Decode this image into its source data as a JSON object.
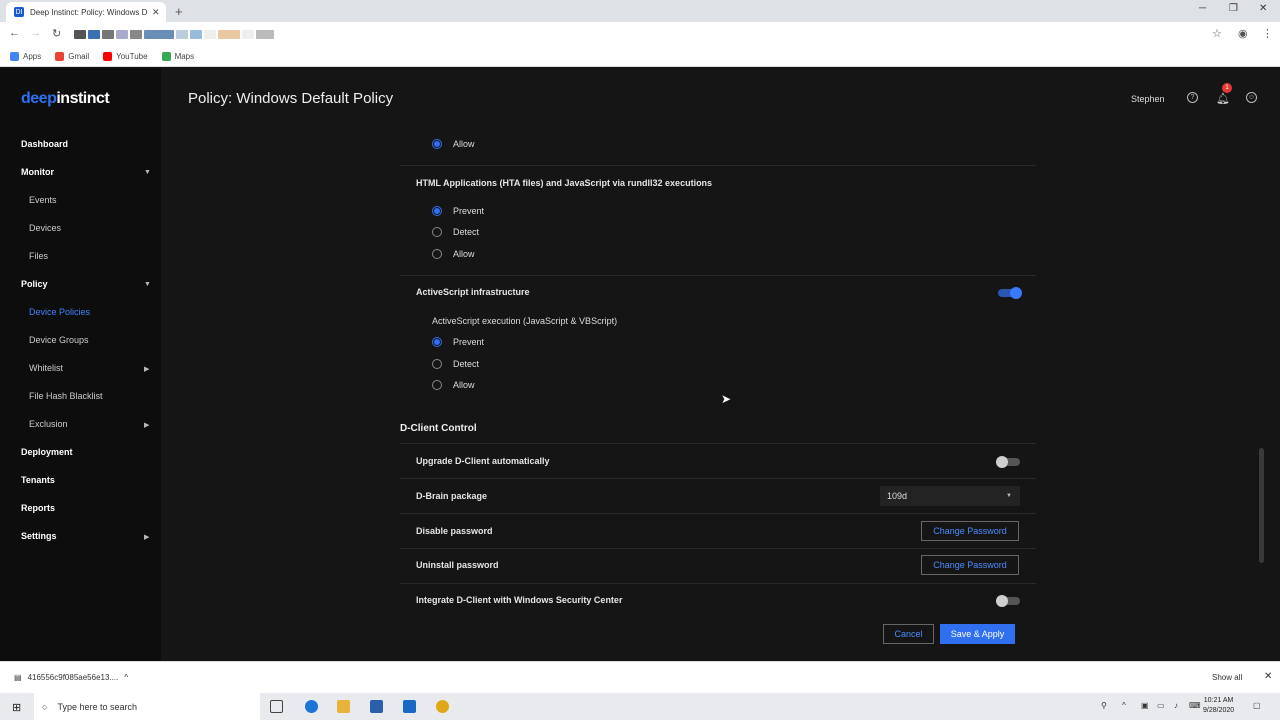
{
  "browser": {
    "tab_title": "Deep Instinct: Policy: Windows D",
    "bookmarks": [
      "Apps",
      "Gmail",
      "YouTube",
      "Maps"
    ]
  },
  "app": {
    "logo_part1": "deep",
    "logo_part2": "instinct",
    "page_title": "Policy: Windows Default Policy",
    "user": "Stephen",
    "notification_count": "1"
  },
  "sidebar": {
    "items": [
      {
        "label": "Dashboard"
      },
      {
        "label": "Monitor"
      },
      {
        "label": "Events"
      },
      {
        "label": "Devices"
      },
      {
        "label": "Files"
      },
      {
        "label": "Policy"
      },
      {
        "label": "Device Policies"
      },
      {
        "label": "Device Groups"
      },
      {
        "label": "Whitelist"
      },
      {
        "label": "File Hash Blacklist"
      },
      {
        "label": "Exclusion"
      },
      {
        "label": "Deployment"
      },
      {
        "label": "Tenants"
      },
      {
        "label": "Reports"
      },
      {
        "label": "Settings"
      }
    ]
  },
  "content": {
    "top_allow": "Allow",
    "hta_title": "HTML Applications (HTA files) and JavaScript via rundll32 executions",
    "hta_options": [
      "Prevent",
      "Detect",
      "Allow"
    ],
    "activescript_title": "ActiveScript infrastructure",
    "activescript_sub": "ActiveScript execution (JavaScript & VBScript)",
    "activescript_options": [
      "Prevent",
      "Detect",
      "Allow"
    ],
    "dclient_section": "D-Client Control",
    "upgrade_label": "Upgrade D-Client automatically",
    "dbrain_label": "D-Brain package",
    "dbrain_value": "109d",
    "disable_password_label": "Disable password",
    "uninstall_password_label": "Uninstall password",
    "change_password": "Change Password",
    "integrate_label": "Integrate D-Client with Windows Security Center",
    "cancel": "Cancel",
    "save_apply": "Save & Apply"
  },
  "downloads": {
    "file": "416556c9f085ae56e13....",
    "show_all": "Show all"
  },
  "taskbar": {
    "search_placeholder": "Type here to search",
    "time": "10:21 AM",
    "date": "9/28/2020"
  },
  "colors": {
    "accent": "#2f6ff0",
    "background": "#151515",
    "sidebar": "#0d0d0d"
  }
}
